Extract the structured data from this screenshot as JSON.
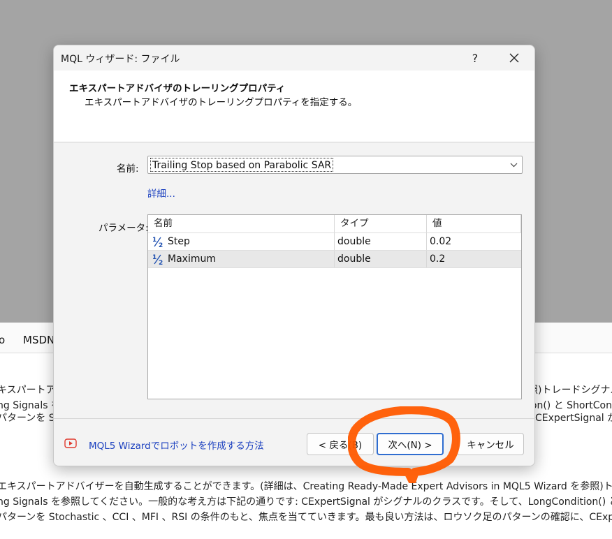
{
  "background": {
    "tabs": [
      "o",
      "MSDN"
    ],
    "lines": [
      "エキスパートアドバイザーを自動生成することができます。(詳細は、Creating Ready-Made Expert Advisors in MQL5 Wizard を参照)トレードシグナルの",
      "ng Signals を参照してください。一般的な考え方は下記の通りです: CExpertSignal がシグナルのクラスです。そして、LongCondition() と ShortCond",
      "パターンを Stochastic 、CCI 、MFI 、RSI の条件のもと、焦点を当てていきます。最も良い方法は、ロウソク足のパターンの確認に、CExpertSignal か"
    ],
    "lines_upper": [
      "キスパートアド",
      "ng Signals を",
      "パターンを Sto"
    ],
    "lines_upper_right": [
      "照)トレードシグナルの",
      "ion() と ShortCond",
      "CExpertSignal か"
    ]
  },
  "dialog": {
    "title": "MQL ウィザード: ファイル",
    "help": "?",
    "close": "✕",
    "header": {
      "title": "エキスパートアドバイザのトレーリングプロパティ",
      "subtitle": "エキスパートアドバイザのトレーリングプロパティを指定する。"
    },
    "name_label": "名前:",
    "name_value": "Trailing Stop based on Parabolic SAR",
    "details_link": "詳細...",
    "params_label": "パラメータ:",
    "grid": {
      "columns": [
        "名前",
        "タイプ",
        "値"
      ],
      "rows": [
        {
          "name": "Step",
          "type": "double",
          "value": "0.02"
        },
        {
          "name": "Maximum",
          "type": "double",
          "value": "0.2"
        }
      ]
    },
    "footer": {
      "tutorial_link": "MQL5 Wizardでロボットを作成する方法",
      "back": "< 戻る(B)",
      "next": "次へ(N) >",
      "cancel": "キャンセル"
    }
  },
  "colors": {
    "link": "#1a3fbf",
    "annotation": "#ff5a00",
    "icon_blue": "#1e4fb0"
  },
  "icons": [
    "half-fraction-icon",
    "youtube-icon",
    "chevron-down-icon",
    "close-icon",
    "help-icon"
  ]
}
